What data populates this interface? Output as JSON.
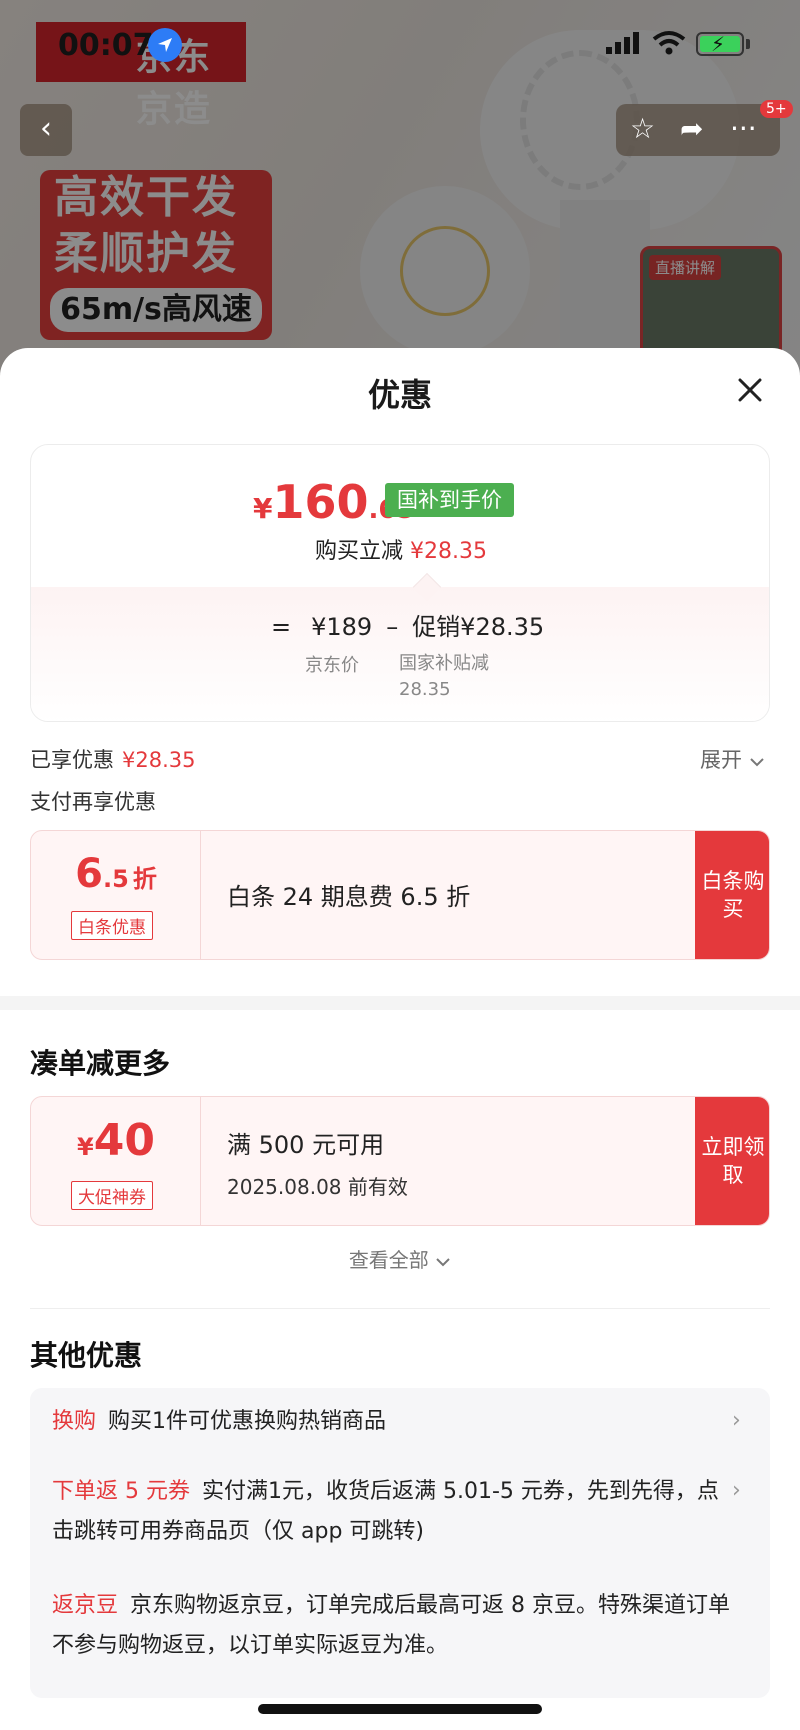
{
  "status_bar": {
    "time": "00:07"
  },
  "background": {
    "brand_text": "京东京造",
    "promo_line1": "高效干发",
    "promo_line2": "柔顺护发",
    "promo_line3": "65m/s高风速",
    "badge": "5+",
    "live_label": "直播讲解"
  },
  "sheet": {
    "title": "优惠",
    "price": {
      "currency": "¥",
      "integer": "160",
      "decimal": ".65",
      "tag": "国补到手价",
      "instant_label": "购买立减",
      "instant_value": "¥28.35",
      "equals": "=",
      "jd_price": "¥189",
      "minus": "–",
      "promo_label": "促销¥28.35",
      "jd_price_label": "京东价",
      "subsidy_label": "国家补贴减 28.35"
    },
    "enjoyed": {
      "label": "已享优惠",
      "value": "¥28.35",
      "expand": "展开"
    },
    "pay_more": "支付再享优惠",
    "baitiao": {
      "value_main": "6",
      "value_dec": ".5",
      "value_unit": "折",
      "tag": "白条优惠",
      "desc": "白条 24 期息费 6.5 折",
      "action": "白条购买"
    },
    "more_title": "凑单减更多",
    "coupon": {
      "currency": "¥",
      "value": "40",
      "tag": "大促神券",
      "desc": "满 500 元可用",
      "expiry": "2025.08.08 前有效",
      "action": "立即领取"
    },
    "view_all": "查看全部",
    "others_title": "其他优惠",
    "others": [
      {
        "key": "换购",
        "text": "购买1件可优惠换购热销商品"
      },
      {
        "key": "下单返 5 元券",
        "text": "实付满1元，收货后返满 5.01-5 元券，先到先得，点击跳转可用券商品页（仅 app 可跳转)"
      },
      {
        "key": "返京豆",
        "text": "京东购物返京豆，订单完成后最高可返 8 京豆。特殊渠道订单不参与购物返豆，以订单实际返豆为准。"
      }
    ]
  },
  "colors": {
    "accent_red": "#e4393c",
    "subsidy_green": "#4caf50"
  }
}
